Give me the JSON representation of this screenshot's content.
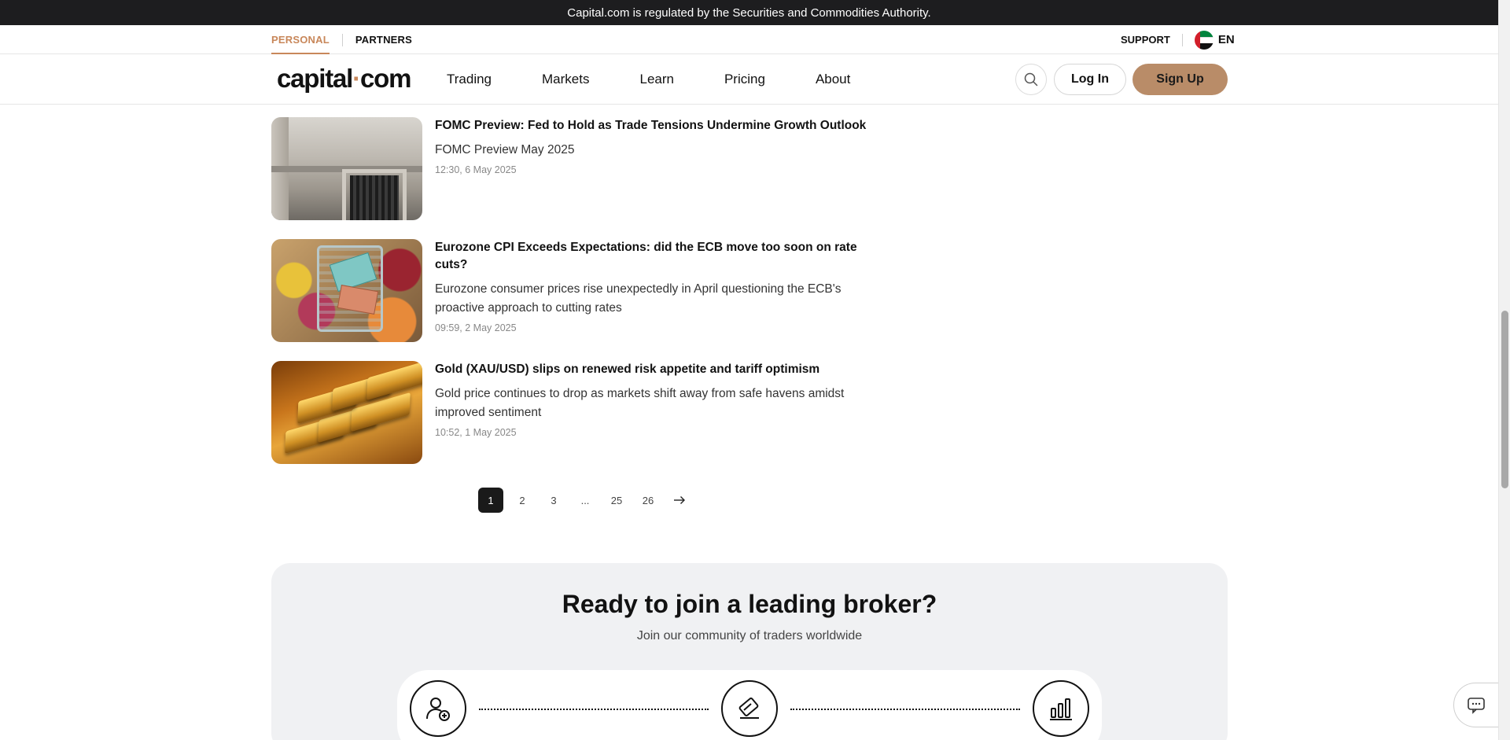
{
  "regulation_banner": "Capital.com is regulated by the Securities and Commodities Authority.",
  "sub_header": {
    "tabs": [
      {
        "label": "PERSONAL",
        "active": true
      },
      {
        "label": "PARTNERS",
        "active": false
      }
    ],
    "support_label": "SUPPORT",
    "language": "EN",
    "flag_icon": "uae-flag-icon"
  },
  "header": {
    "logo_text_left": "capital",
    "logo_dot": "·",
    "logo_text_right": "com",
    "nav": [
      "Trading",
      "Markets",
      "Learn",
      "Pricing",
      "About"
    ],
    "search_icon": "search-icon",
    "login_label": "Log In",
    "signup_label": "Sign Up"
  },
  "articles": [
    {
      "title": "FOMC Preview: Fed to Hold as Trade Tensions Undermine Growth Outlook",
      "summary": "FOMC Preview May 2025",
      "date": "12:30, 6 May 2025"
    },
    {
      "title": "Eurozone CPI Exceeds Expectations: did the ECB move too soon on rate cuts?",
      "summary": "Eurozone consumer prices rise unexpectedly in April questioning the ECB's proactive approach to cutting rates",
      "date": "09:59, 2 May 2025"
    },
    {
      "title": "Gold (XAU/USD) slips on renewed risk appetite and tariff optimism",
      "summary": "Gold price continues to drop as markets shift away from safe havens amidst improved sentiment",
      "date": "10:52, 1 May 2025"
    }
  ],
  "pagination": {
    "pages": [
      "1",
      "2",
      "3",
      "...",
      "25",
      "26"
    ],
    "current": "1",
    "next_icon": "arrow-right-icon"
  },
  "cta": {
    "title": "Ready to join a leading broker?",
    "subtitle": "Join our community of traders worldwide",
    "step_icons": [
      "user-add-icon",
      "verify-card-icon",
      "bar-chart-icon"
    ]
  },
  "chat_icon": "chat-icon",
  "colors": {
    "accent": "#c8875a",
    "signup_bg": "#b98c68",
    "banner_bg": "#1d1d1f",
    "cta_bg": "#f0f1f3"
  }
}
